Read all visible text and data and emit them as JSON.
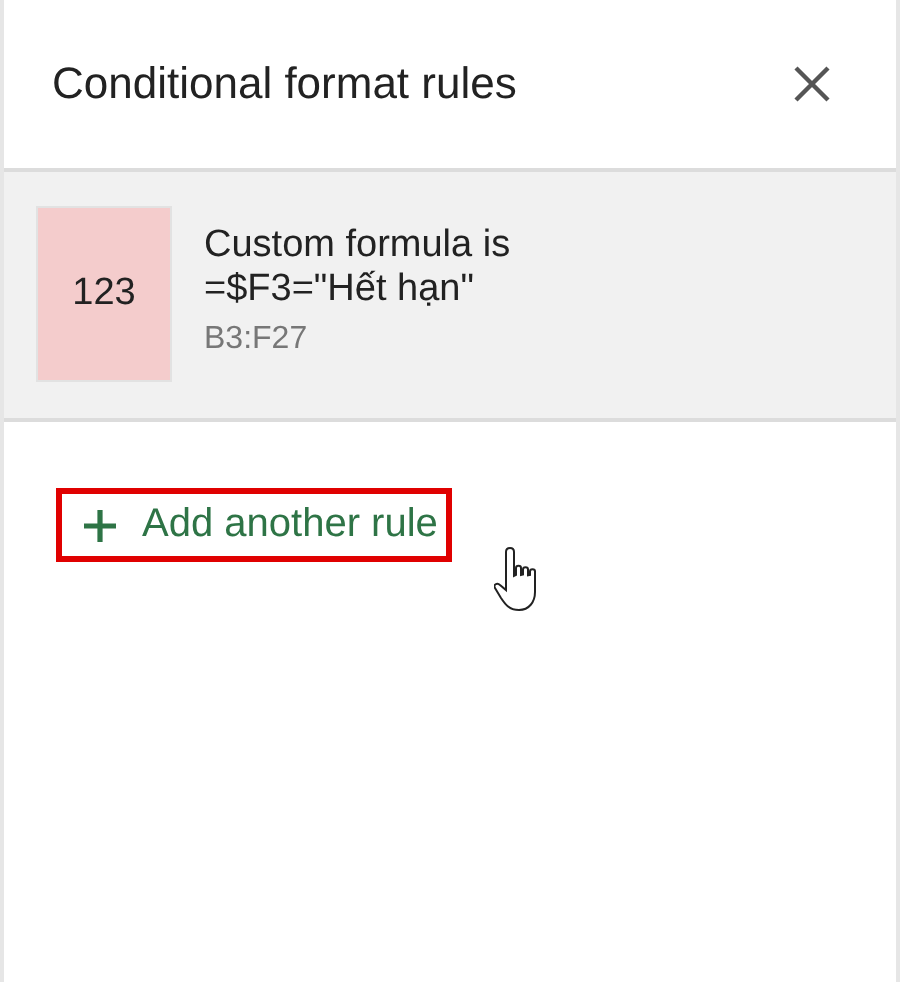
{
  "panel": {
    "title": "Conditional format rules"
  },
  "rules": [
    {
      "preview": "123",
      "color": "#f4cccc",
      "condition": "Custom formula is",
      "formula": "=$F3=\"Hết hạn\"",
      "range": "B3:F27"
    }
  ],
  "add_button": {
    "label": "Add another rule",
    "highlighted": true
  }
}
